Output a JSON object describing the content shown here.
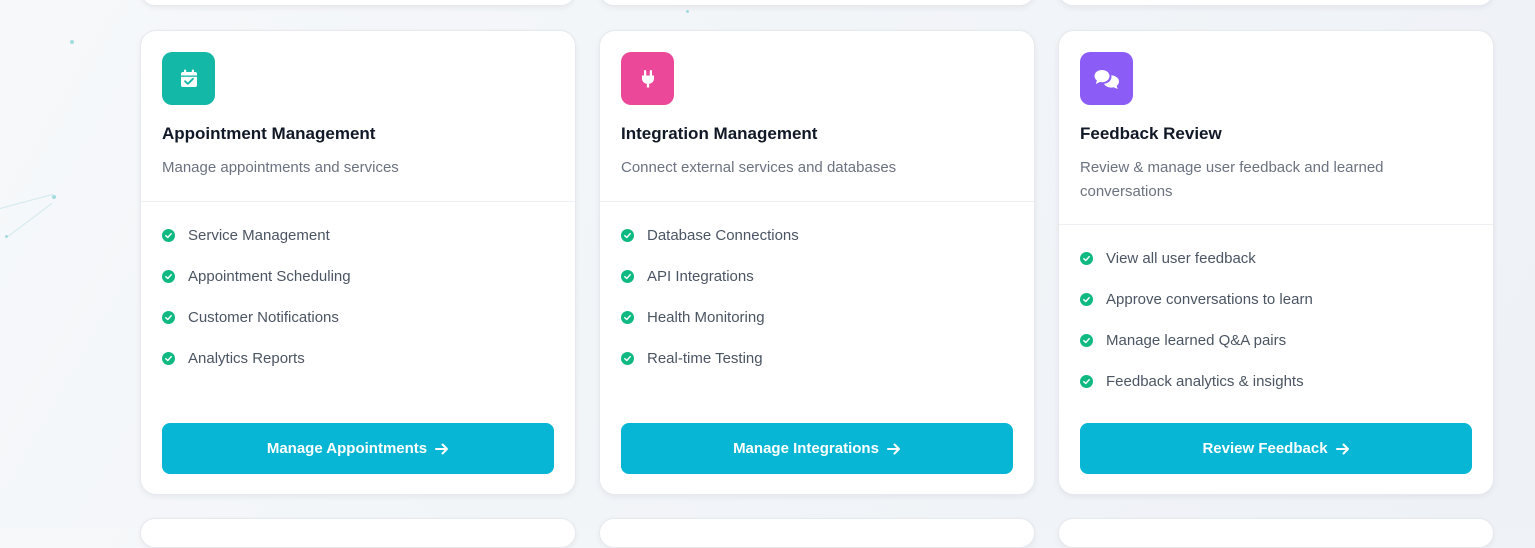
{
  "cards": [
    {
      "icon": "calendar-check-icon",
      "icon_color": "#14b8a6",
      "title": "Appointment Management",
      "description": "Manage appointments and services",
      "features": [
        "Service Management",
        "Appointment Scheduling",
        "Customer Notifications",
        "Analytics Reports"
      ],
      "button_label": "Manage Appointments"
    },
    {
      "icon": "plug-icon",
      "icon_color": "#ec4899",
      "title": "Integration Management",
      "description": "Connect external services and databases",
      "features": [
        "Database Connections",
        "API Integrations",
        "Health Monitoring",
        "Real-time Testing"
      ],
      "button_label": "Manage Integrations"
    },
    {
      "icon": "comments-icon",
      "icon_color": "#8b5cf6",
      "title": "Feedback Review",
      "description": "Review & manage user feedback and learned conversations",
      "features": [
        "View all user feedback",
        "Approve conversations to learn",
        "Manage learned Q&A pairs",
        "Feedback analytics & insights"
      ],
      "button_label": "Review Feedback"
    }
  ],
  "colors": {
    "button": "#06b6d4",
    "check": "#10b981",
    "title": "#111827",
    "description": "#6b7280"
  }
}
